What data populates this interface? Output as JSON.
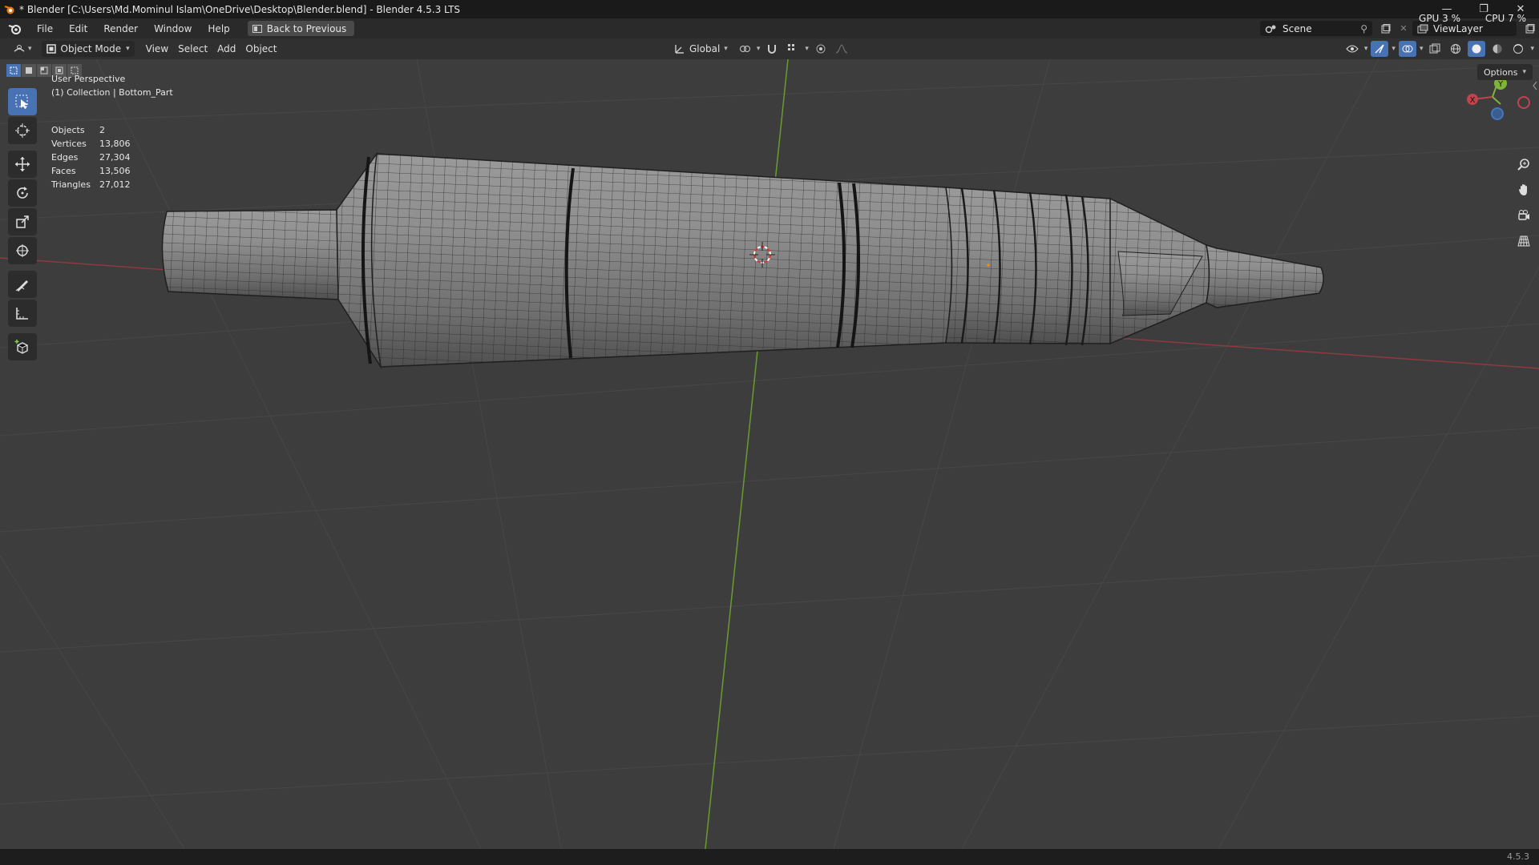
{
  "window": {
    "title": "* Blender [C:\\Users\\Md.Mominul Islam\\OneDrive\\Desktop\\Blender.blend] - Blender 4.5.3 LTS",
    "minimize_glyph": "—",
    "restore_glyph": "❐",
    "close_glyph": "✕"
  },
  "menubar": {
    "items": [
      "File",
      "Edit",
      "Render",
      "Window",
      "Help"
    ],
    "back_button": "Back to Previous",
    "scene": "Scene",
    "view_layer": "ViewLayer",
    "gpu": "GPU  3 %",
    "cpu": "CPU  7 %"
  },
  "header": {
    "mode": "Object Mode",
    "menus": [
      "View",
      "Select",
      "Add",
      "Object"
    ],
    "transform_orientation": "Global"
  },
  "viewport": {
    "perspective": "User Perspective",
    "collection": "(1) Collection | Bottom_Part",
    "options": "Options",
    "stats": [
      {
        "label": "Objects",
        "value": "2"
      },
      {
        "label": "Vertices",
        "value": "13,806"
      },
      {
        "label": "Edges",
        "value": "27,304"
      },
      {
        "label": "Faces",
        "value": "13,506"
      },
      {
        "label": "Triangles",
        "value": "27,012"
      }
    ],
    "gizmo_axes": {
      "x": "X",
      "y": "Y"
    },
    "colors": {
      "background": "#3d3d3d",
      "accent": "#4772b3",
      "x_axis": "#c0444d",
      "y_axis": "#7fb43a",
      "z_axis": "#4077c4"
    }
  },
  "status": {
    "version": "4.5.3"
  }
}
